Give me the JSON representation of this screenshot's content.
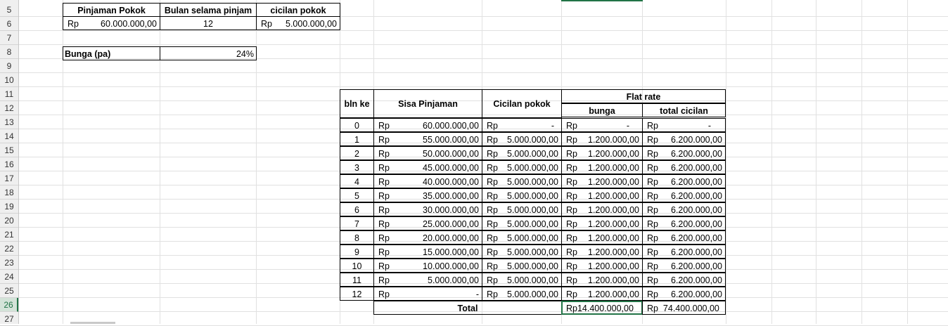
{
  "row_numbers": [
    "5",
    "6",
    "7",
    "8",
    "9",
    "10",
    "11",
    "12",
    "13",
    "14",
    "15",
    "16",
    "17",
    "18",
    "19",
    "20",
    "21",
    "22",
    "23",
    "24",
    "25",
    "26",
    "27"
  ],
  "active_row": "26",
  "summary": {
    "headers": [
      "Pinjaman Pokok",
      "Bulan selama pinjam",
      "cicilan pokok"
    ],
    "currency": "Rp",
    "pinjaman_pokok": "60.000.000,00",
    "bulan": "12",
    "cicilan_pokok": "5.000.000,00",
    "bunga_label": "Bunga (pa)",
    "bunga_value": "24%"
  },
  "table": {
    "col_bln": "bln ke",
    "col_sisa": "Sisa Pinjaman",
    "col_cicilan": "Cicilan pokok",
    "group_flat": "Flat rate",
    "col_bunga": "bunga",
    "col_total": "total cicilan",
    "rows": [
      {
        "bln": "0",
        "rp": "Rp",
        "sisa": "60.000.000,00",
        "cicilan": "-",
        "bunga": "-",
        "total": "-"
      },
      {
        "bln": "1",
        "rp": "Rp",
        "sisa": "55.000.000,00",
        "cicilan": "5.000.000,00",
        "bunga": "1.200.000,00",
        "total": "6.200.000,00"
      },
      {
        "bln": "2",
        "rp": "Rp",
        "sisa": "50.000.000,00",
        "cicilan": "5.000.000,00",
        "bunga": "1.200.000,00",
        "total": "6.200.000,00"
      },
      {
        "bln": "3",
        "rp": "Rp",
        "sisa": "45.000.000,00",
        "cicilan": "5.000.000,00",
        "bunga": "1.200.000,00",
        "total": "6.200.000,00"
      },
      {
        "bln": "4",
        "rp": "Rp",
        "sisa": "40.000.000,00",
        "cicilan": "5.000.000,00",
        "bunga": "1.200.000,00",
        "total": "6.200.000,00"
      },
      {
        "bln": "5",
        "rp": "Rp",
        "sisa": "35.000.000,00",
        "cicilan": "5.000.000,00",
        "bunga": "1.200.000,00",
        "total": "6.200.000,00"
      },
      {
        "bln": "6",
        "rp": "Rp",
        "sisa": "30.000.000,00",
        "cicilan": "5.000.000,00",
        "bunga": "1.200.000,00",
        "total": "6.200.000,00"
      },
      {
        "bln": "7",
        "rp": "Rp",
        "sisa": "25.000.000,00",
        "cicilan": "5.000.000,00",
        "bunga": "1.200.000,00",
        "total": "6.200.000,00"
      },
      {
        "bln": "8",
        "rp": "Rp",
        "sisa": "20.000.000,00",
        "cicilan": "5.000.000,00",
        "bunga": "1.200.000,00",
        "total": "6.200.000,00"
      },
      {
        "bln": "9",
        "rp": "Rp",
        "sisa": "15.000.000,00",
        "cicilan": "5.000.000,00",
        "bunga": "1.200.000,00",
        "total": "6.200.000,00"
      },
      {
        "bln": "10",
        "rp": "Rp",
        "sisa": "10.000.000,00",
        "cicilan": "5.000.000,00",
        "bunga": "1.200.000,00",
        "total": "6.200.000,00"
      },
      {
        "bln": "11",
        "rp": "Rp",
        "sisa": "5.000.000,00",
        "cicilan": "5.000.000,00",
        "bunga": "1.200.000,00",
        "total": "6.200.000,00"
      },
      {
        "bln": "12",
        "rp": "Rp",
        "sisa": "-",
        "cicilan": "5.000.000,00",
        "bunga": "1.200.000,00",
        "total": "6.200.000,00"
      }
    ],
    "total_label": "Total",
    "total_bunga": "Rp14.400.000,00",
    "total_cicilan": "Rp  74.400.000,00"
  },
  "colors": {
    "selection": "#217346",
    "gridline": "#e1e1e1",
    "header_bg": "#efefef"
  }
}
